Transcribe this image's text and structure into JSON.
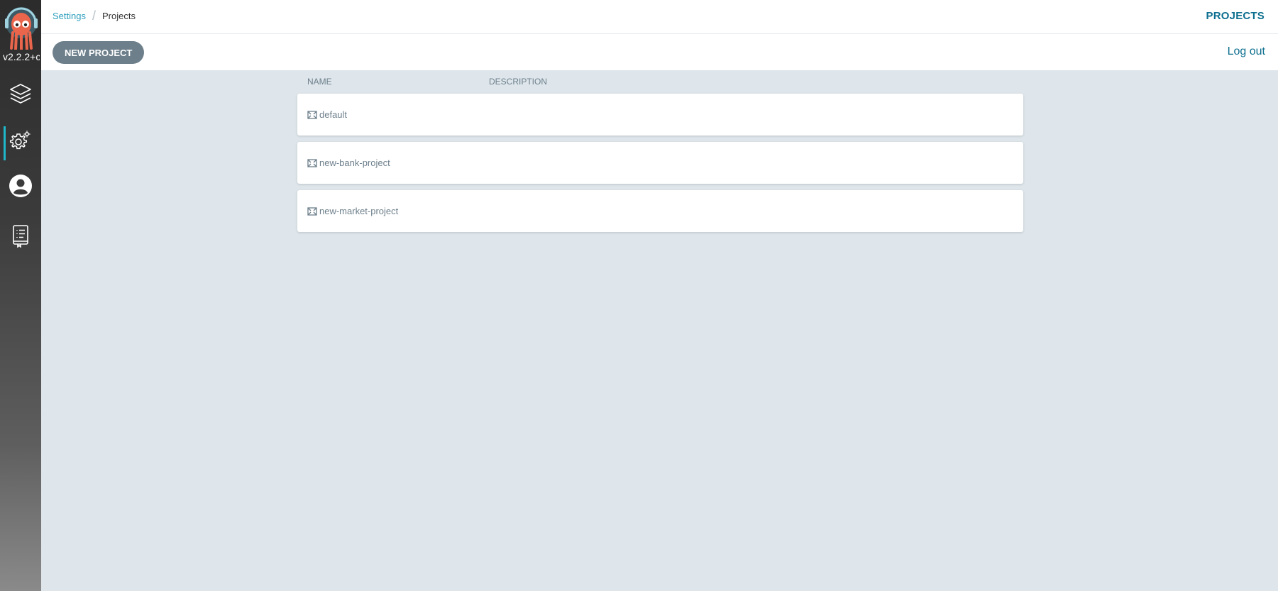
{
  "app": {
    "version": "v2.2.2+c",
    "colors": {
      "accent": "#1fb7c9",
      "brand": "#0d6f8f",
      "button": "#6d7f8b",
      "logo": "#e9654b"
    }
  },
  "sidebar": {
    "items": [
      {
        "name": "applications",
        "icon": "layers-icon"
      },
      {
        "name": "settings",
        "icon": "gear-icon",
        "active": true
      },
      {
        "name": "user-info",
        "icon": "user-circle-icon"
      },
      {
        "name": "documentation",
        "icon": "docs-icon"
      }
    ]
  },
  "breadcrumb": {
    "parent": "Settings",
    "separator": "/",
    "current": "Projects"
  },
  "header": {
    "title": "PROJECTS"
  },
  "toolbar": {
    "new_project_label": "NEW PROJECT",
    "logout_label": "Log out"
  },
  "table": {
    "columns": [
      "NAME",
      "DESCRIPTION"
    ],
    "rows": [
      {
        "name": "default",
        "description": "",
        "icon": "project-icon"
      },
      {
        "name": "new-bank-project",
        "description": "",
        "icon": "project-icon"
      },
      {
        "name": "new-market-project",
        "description": "",
        "icon": "project-icon"
      }
    ]
  }
}
